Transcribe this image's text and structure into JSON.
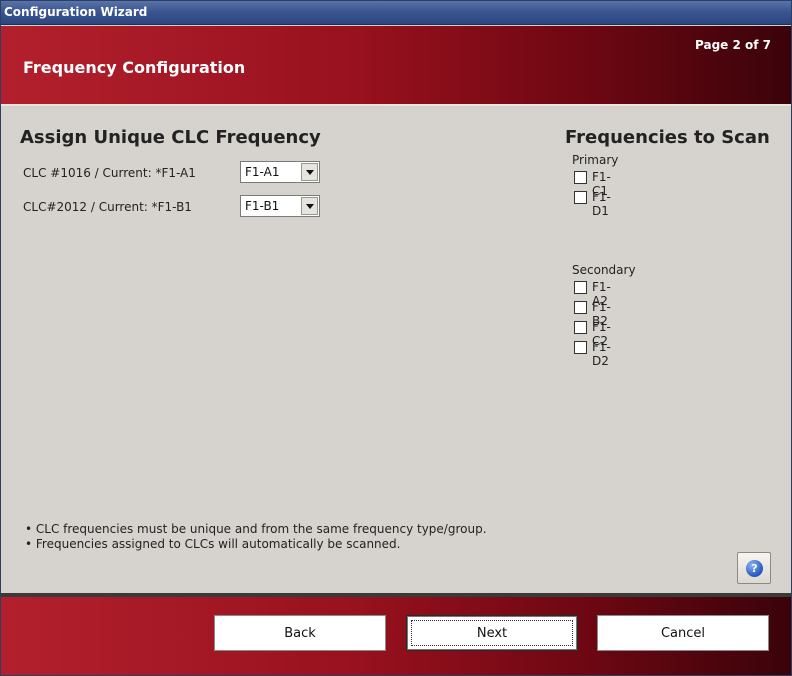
{
  "window": {
    "title": "Configuration Wizard"
  },
  "header": {
    "title": "Frequency Configuration",
    "page_indicator": "Page 2 of 7"
  },
  "assign": {
    "title": "Assign Unique CLC Frequency",
    "rows": [
      {
        "label": "CLC #1016  / Current: *F1-A1",
        "selected": "F1-A1"
      },
      {
        "label": "CLC#2012  / Current: *F1-B1",
        "selected": "F1-B1"
      }
    ]
  },
  "scan": {
    "title": "Frequencies to Scan",
    "primary_label": "Primary",
    "primary": [
      {
        "label": "F1-C1",
        "checked": false
      },
      {
        "label": "F1-D1",
        "checked": false
      }
    ],
    "secondary_label": "Secondary",
    "secondary": [
      {
        "label": "F1-A2",
        "checked": false
      },
      {
        "label": "F1-B2",
        "checked": false
      },
      {
        "label": "F1-C2",
        "checked": false
      },
      {
        "label": "F1-D2",
        "checked": false
      }
    ]
  },
  "notes": [
    "• CLC frequencies must be unique and from the same frequency type/group.",
    "• Frequencies assigned to CLCs will automatically be scanned."
  ],
  "help": {
    "icon": "help-icon",
    "glyph": "?"
  },
  "footer": {
    "back_label": "Back",
    "next_label": "Next",
    "cancel_label": "Cancel"
  },
  "colors": {
    "header_start": "#b3202d",
    "header_end": "#3a0309",
    "titlebar": "#3a5590",
    "panel": "#d6d3ce"
  }
}
